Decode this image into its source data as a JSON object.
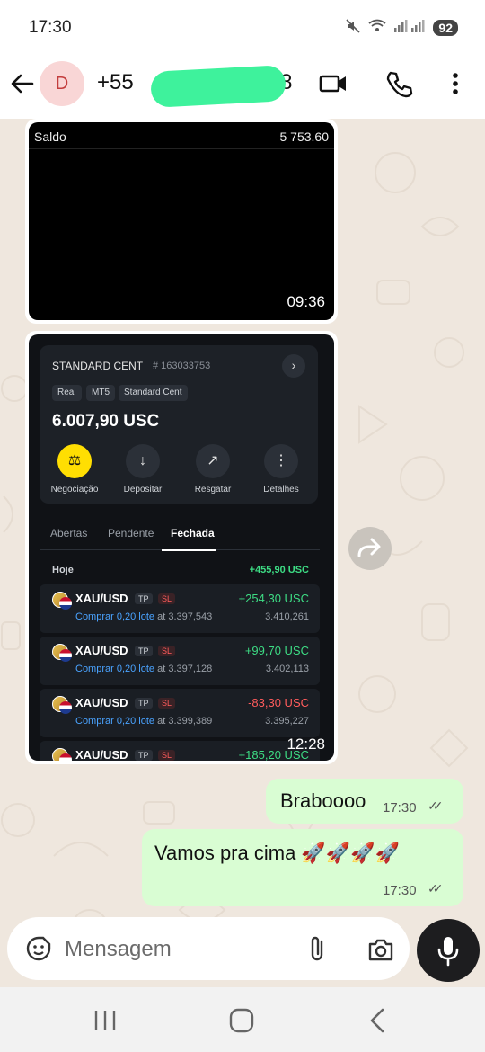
{
  "status_bar": {
    "time": "17:30",
    "battery": "92"
  },
  "header": {
    "avatar_letter": "D",
    "contact_name": "+55",
    "contact_suffix": "98"
  },
  "messages": {
    "image1": {
      "saldo_label": "Saldo",
      "saldo_value": "5 753.60",
      "time": "09:36"
    },
    "image2": {
      "account_title": "STANDARD CENT",
      "account_number": "# 163033753",
      "tags": [
        "Real",
        "MT5",
        "Standard Cent"
      ],
      "balance": "6.007,90 USC",
      "actions": [
        "Negociação",
        "Depositar",
        "Resgatar",
        "Detalhes"
      ],
      "tabs": [
        "Abertas",
        "Pendente",
        "Fechada"
      ],
      "day_label": "Hoje",
      "day_total": "+455,90 USC",
      "trades": [
        {
          "symbol": "XAU/USD",
          "tp": "TP",
          "sl": "SL",
          "pnl": "+254,30 USC",
          "action": "Comprar 0,20 lote",
          "open_price": "at 3.397,543",
          "close_price": "3.410,261"
        },
        {
          "symbol": "XAU/USD",
          "tp": "TP",
          "sl": "SL",
          "pnl": "+99,70 USC",
          "action": "Comprar 0,20 lote",
          "open_price": "at 3.397,128",
          "close_price": "3.402,113"
        },
        {
          "symbol": "XAU/USD",
          "tp": "TP",
          "sl": "SL",
          "pnl": "-83,30 USC",
          "action": "Comprar 0,20 lote",
          "open_price": "at 3.399,389",
          "close_price": "3.395,227"
        },
        {
          "symbol": "XAU/USD",
          "tp": "TP",
          "sl": "SL",
          "pnl": "+185,20 USC"
        }
      ],
      "time": "12:28"
    },
    "outgoing": [
      {
        "text": "Braboooo",
        "time": "17:30"
      },
      {
        "text": "Vamos pra cima 🚀🚀🚀🚀",
        "time": "17:30"
      }
    ]
  },
  "input": {
    "placeholder": "Mensagem"
  },
  "icons": [
    "back-arrow-icon",
    "video-call-icon",
    "phone-call-icon",
    "more-options-icon",
    "forward-icon",
    "sticker-icon",
    "attach-icon",
    "camera-icon",
    "mic-icon",
    "recents-icon",
    "home-icon",
    "back-nav-icon"
  ],
  "colors": {
    "outgoing_bubble": "#d9fdd3",
    "profit": "#3ddc84",
    "loss": "#ff5c5c",
    "primary_action": "#ffde02",
    "redaction": "#3ef29c"
  }
}
